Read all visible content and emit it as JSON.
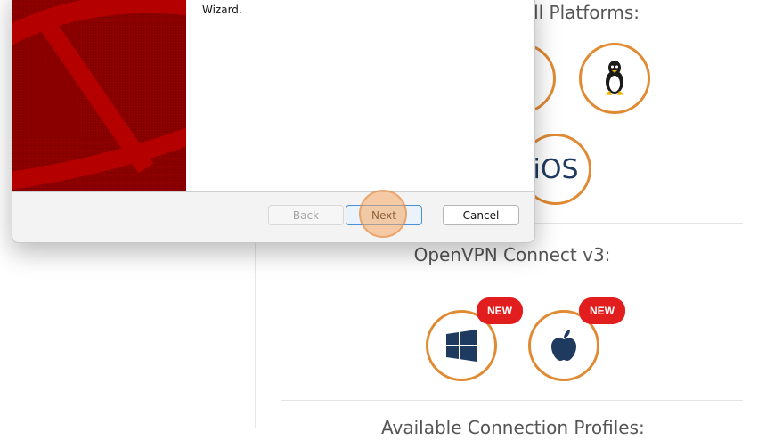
{
  "page": {
    "platforms_heading": "or all Platforms:",
    "ios_label": "iOS",
    "connect_heading": "OpenVPN Connect v3:",
    "new_badge": "NEW",
    "profiles_heading": "Available Connection Profiles:"
  },
  "dialog": {
    "text": "Wizard.",
    "buttons": {
      "back": "Back",
      "next": "Next",
      "cancel": "Cancel"
    }
  },
  "icons": [
    "linux-icon",
    "windows-icon",
    "apple-icon"
  ],
  "colors": {
    "accent_orange": "#e08a33",
    "badge_red": "#e21d1d",
    "banner_red": "#8c0000",
    "ios_navy": "#1f3a5f"
  }
}
